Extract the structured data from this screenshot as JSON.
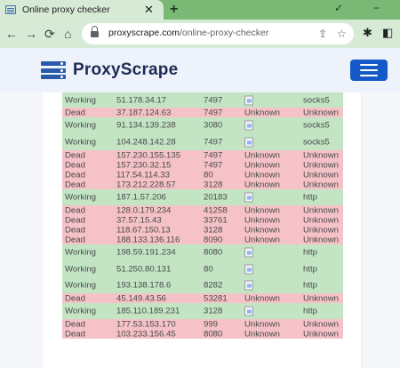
{
  "browser": {
    "tab_title": "Online proxy checker",
    "tab_close": "✕",
    "new_tab": "+",
    "url_host": "proxyscrape.com",
    "url_path": "/online-proxy-checker",
    "window_controls": [
      "✓",
      "−"
    ],
    "accent_color": "#79b875"
  },
  "site": {
    "brand": "ProxyScrape",
    "brand_color": "#1d2b53",
    "menu_button_color": "#1459c7"
  },
  "results": {
    "working_color": "#c3e5c4",
    "dead_color": "#f5c2c7",
    "rows": [
      {
        "status": "Working",
        "ip": "51.178.34.17",
        "port": "7497",
        "country": "",
        "protocol": "socks5"
      },
      {
        "status": "Dead",
        "ip": "37.187.124.63",
        "port": "7497",
        "country": "Unknown",
        "protocol": "Unknown"
      },
      {
        "status": "Working",
        "ip": "91.134.139.238",
        "port": "3080",
        "country": "",
        "protocol": "socks5"
      },
      {
        "status": "Working",
        "ip": "104.248.142.28",
        "port": "7497",
        "country": "",
        "protocol": "socks5"
      },
      {
        "status": "Dead",
        "ip": "157.230.155.135",
        "port": "7497",
        "country": "Unknown",
        "protocol": "Unknown"
      },
      {
        "status": "Dead",
        "ip": "157.230.32.15",
        "port": "7497",
        "country": "Unknown",
        "protocol": "Unknown"
      },
      {
        "status": "Dead",
        "ip": "117.54.114.33",
        "port": "80",
        "country": "Unknown",
        "protocol": "Unknown"
      },
      {
        "status": "Dead",
        "ip": "173.212.228.57",
        "port": "3128",
        "country": "Unknown",
        "protocol": "Unknown"
      },
      {
        "status": "Working",
        "ip": "187.1.57.206",
        "port": "20183",
        "country": "",
        "protocol": "http"
      },
      {
        "status": "Dead",
        "ip": "128.0.179.234",
        "port": "41258",
        "country": "Unknown",
        "protocol": "Unknown"
      },
      {
        "status": "Dead",
        "ip": "37.57.15.43",
        "port": "33761",
        "country": "Unknown",
        "protocol": "Unknown"
      },
      {
        "status": "Dead",
        "ip": "118.67.150.13",
        "port": "3128",
        "country": "Unknown",
        "protocol": "Unknown"
      },
      {
        "status": "Dead",
        "ip": "188.133.136.116",
        "port": "8090",
        "country": "Unknown",
        "protocol": "Unknown"
      },
      {
        "status": "Working",
        "ip": "198.59.191.234",
        "port": "8080",
        "country": "",
        "protocol": "http"
      },
      {
        "status": "Working",
        "ip": "51.250.80.131",
        "port": "80",
        "country": "",
        "protocol": "http"
      },
      {
        "status": "Working",
        "ip": "193.138.178.6",
        "port": "8282",
        "country": "",
        "protocol": "http"
      },
      {
        "status": "Dead",
        "ip": "45.149.43.56",
        "port": "53281",
        "country": "Unknown",
        "protocol": "Unknown"
      },
      {
        "status": "Working",
        "ip": "185.110.189.231",
        "port": "3128",
        "country": "",
        "protocol": "http"
      },
      {
        "status": "Dead",
        "ip": "177.53.153.170",
        "port": "999",
        "country": "Unknown",
        "protocol": "Unknown"
      },
      {
        "status": "Dead",
        "ip": "103.233.156.45",
        "port": "8080",
        "country": "Unknown",
        "protocol": "Unknown"
      }
    ]
  }
}
